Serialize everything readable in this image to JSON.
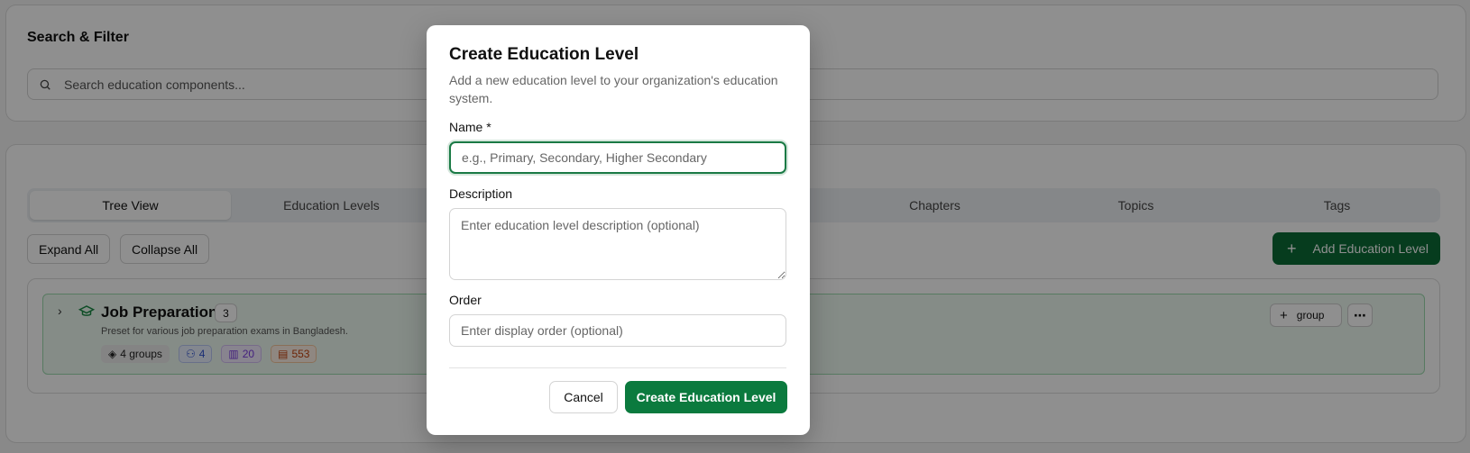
{
  "search": {
    "title": "Search & Filter",
    "placeholder": "Search education components..."
  },
  "tabs": [
    {
      "label": "Tree View",
      "active": true
    },
    {
      "label": "Education Levels",
      "active": false
    },
    {
      "label": "",
      "active": false
    },
    {
      "label": "",
      "active": false
    },
    {
      "label": "Chapters",
      "active": false
    },
    {
      "label": "Topics",
      "active": false
    },
    {
      "label": "Tags",
      "active": false
    }
  ],
  "toolbar": {
    "expand_all": "Expand All",
    "collapse_all": "Collapse All",
    "add_education_level": "Add Education Level"
  },
  "tree": {
    "items": [
      {
        "title": "Job Preparation",
        "count": "3",
        "description": "Preset for various job preparation exams in Bangladesh.",
        "chips": {
          "groups": "4 groups",
          "users": "4",
          "books": "20",
          "docs": "553"
        },
        "group_button": "group",
        "more": "⋯"
      }
    ]
  },
  "modal": {
    "title": "Create Education Level",
    "description": "Add a new education level to your organization's education system.",
    "name_label": "Name *",
    "name_placeholder": "e.g., Primary, Secondary, Higher Secondary",
    "description_label": "Description",
    "description_placeholder": "Enter education level description (optional)",
    "order_label": "Order",
    "order_placeholder": "Enter display order (optional)",
    "cancel": "Cancel",
    "submit": "Create Education Level"
  },
  "colors": {
    "accent": "#0b7a3e",
    "overlay": "rgba(0,0,0,0.44)"
  }
}
